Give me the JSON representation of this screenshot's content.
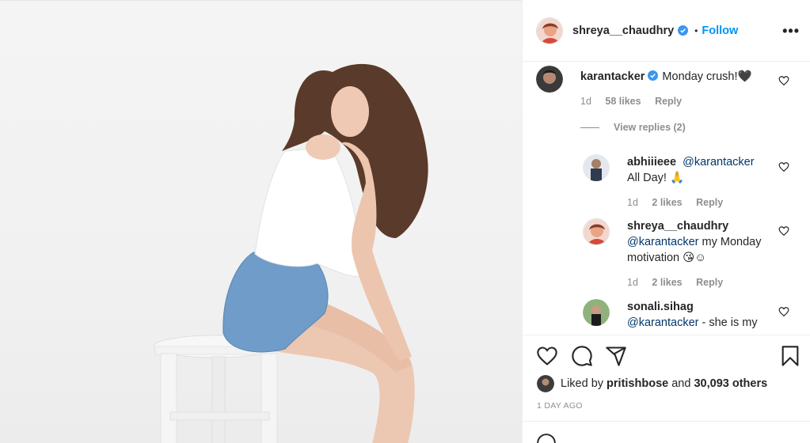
{
  "post": {
    "author": "shreya__chaudhry",
    "follow_label": "Follow",
    "dot": "•",
    "more_label": "•••"
  },
  "comments": [
    {
      "username": "karantacker",
      "verified": true,
      "text": "Monday crush!🖤",
      "time": "1d",
      "likes": "58 likes",
      "reply": "Reply",
      "view_replies": "View replies (2)"
    },
    {
      "username": "abhiiieee",
      "mention": "@karantacker",
      "text": "All Day! 🙏",
      "time": "1d",
      "likes": "2 likes",
      "reply": "Reply"
    },
    {
      "username": "shreya__chaudhry",
      "mention": "@karantacker",
      "text": "my Monday motivation 😘☺",
      "time": "1d",
      "likes": "2 likes",
      "reply": "Reply"
    },
    {
      "username": "sonali.sihag",
      "mention": "@karantacker",
      "text": "- she is my"
    }
  ],
  "liked_by": {
    "prefix": "Liked by",
    "user": "pritishbose",
    "and": "and",
    "others": "30,093 others"
  },
  "timestamp": "1 DAY AGO",
  "icons": {
    "like": "heart-icon",
    "comment": "comment-icon",
    "share": "share-icon",
    "save": "bookmark-icon",
    "verified": "verified-badge-icon"
  },
  "colors": {
    "accent": "#0095f6",
    "mention": "#00376b",
    "muted": "#8e8e8e"
  }
}
